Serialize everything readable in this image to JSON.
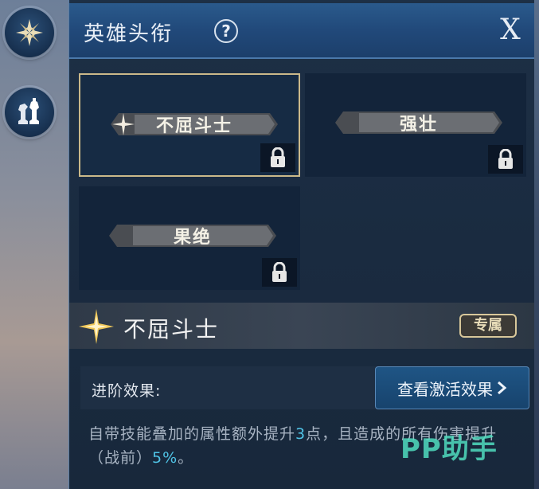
{
  "header": {
    "title": "英雄头衔",
    "help_icon": "question-circle-icon",
    "help_text": "?",
    "close_text": "X"
  },
  "sidebar": {
    "items": [
      {
        "icon": "compass-emblem-icon"
      },
      {
        "icon": "chess-pieces-icon"
      }
    ]
  },
  "titles": [
    {
      "label": "不屈斗士",
      "selected": true,
      "locked": true,
      "has_star": true
    },
    {
      "label": "强壮",
      "selected": false,
      "locked": true,
      "has_star": false
    },
    {
      "label": "果绝",
      "selected": false,
      "locked": true,
      "has_star": false
    }
  ],
  "detail": {
    "name": "不屈斗士",
    "badge": "专属"
  },
  "advanced": {
    "label": "进阶效果:",
    "button": "查看激活效果"
  },
  "description": {
    "part1": "自带技能叠加的属性额外提升",
    "value1": "3",
    "part2": "点，且造成的所有伤害提升（战前）",
    "value2": "5%",
    "part3": "。"
  },
  "watermark": "PP助手",
  "colors": {
    "accent_blue": "#4fc3e6",
    "selected_border": "#cbb98a",
    "header_bg": "#21497a"
  }
}
